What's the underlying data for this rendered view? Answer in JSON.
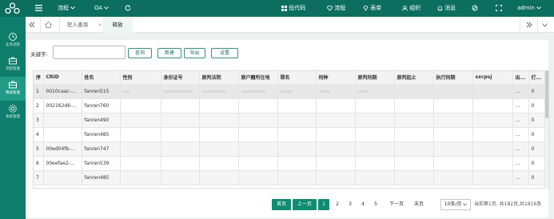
{
  "topbar": {
    "nav_process": "流程",
    "nav_oa": "OA",
    "low_code": "低代码",
    "process": "流程",
    "form": "表单",
    "org": "组织",
    "messages": "消息",
    "user": "admin"
  },
  "sidebar": {
    "items": [
      {
        "label": "业务流程"
      },
      {
        "label": "流程管理"
      },
      {
        "label": "释放管理"
      },
      {
        "label": "系统管理"
      }
    ]
  },
  "tabs": {
    "tab1": "犯人查询",
    "tab1_close": "×",
    "tab2": "释放"
  },
  "search": {
    "label": "关键字:",
    "value": "",
    "query": "查询",
    "create": "新建",
    "export": "导出",
    "settings": "设置"
  },
  "table": {
    "headers": [
      "序",
      "CRID",
      "姓名",
      "性别",
      "身份证号",
      "原判法院",
      "原户籍所在地",
      "罪名",
      "刑种",
      "原判刑期",
      "原判起止",
      "执行刑期",
      "sxcpsj",
      "出...",
      "打..."
    ],
    "rows": [
      {
        "n": "1",
        "crid": "0010caac-...",
        "name": "fanren515",
        "c1": "...",
        "c2": "0"
      },
      {
        "n": "2",
        "crid": "002162d6-...",
        "name": "fanren760",
        "c1": "...",
        "c2": "0"
      },
      {
        "n": "3",
        "crid": "",
        "name": "fanren490",
        "c1": "...",
        "c2": "0"
      },
      {
        "n": "4",
        "crid": "",
        "name": "fanren485",
        "c1": "...",
        "c2": "0"
      },
      {
        "n": "5",
        "crid": "00ed04fb-...",
        "name": "fanren747",
        "c1": "...",
        "c2": "0"
      },
      {
        "n": "6",
        "crid": "00eefae2-...",
        "name": "fanren539",
        "c1": "...",
        "c2": "0"
      },
      {
        "n": "7",
        "crid": "",
        "name": "fanren485",
        "c1": "...",
        "c2": "0"
      }
    ]
  },
  "pagination": {
    "first": "首页",
    "prev": "上一页",
    "pages": [
      "1",
      "2",
      "3",
      "4",
      "5"
    ],
    "next": "下一页",
    "last": "末页",
    "page_size": "10条/页",
    "info": "当前第1页, 共182页,共1816条"
  },
  "colors": {
    "brand": "#0b6e5f",
    "sidebar": "#0f7d6c",
    "accent": "#0f8c72"
  }
}
